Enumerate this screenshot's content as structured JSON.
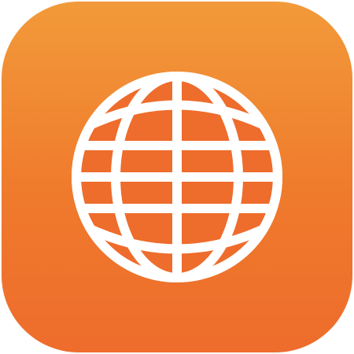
{
  "icon": {
    "name": "globe-icon",
    "colors": {
      "background_top": "#f29a3a",
      "background_bottom": "#ee6c2c",
      "globe_fill": "#ee6c2c",
      "globe_stroke": "#ffffff"
    }
  }
}
